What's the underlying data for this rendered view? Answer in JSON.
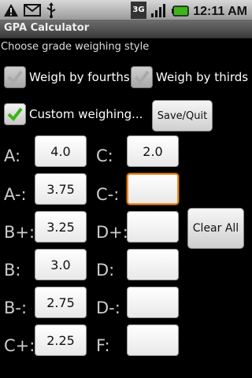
{
  "statusbar": {
    "time": "12:11 AM",
    "icons": [
      "warning-icon",
      "gmail-icon",
      "usb-icon",
      "3g-icon",
      "signal-icon",
      "battery-icon"
    ],
    "network_label": "3G"
  },
  "titlebar": {
    "title": "GPA Calculator"
  },
  "subtitle": "Choose grade weighing style",
  "options": {
    "fourths": {
      "label": "Weigh by fourths",
      "checked": true,
      "enabled": false
    },
    "thirds": {
      "label": "Weigh by thirds",
      "checked": true,
      "enabled": false
    },
    "custom": {
      "label": "Custom weighing...",
      "checked": true,
      "enabled": true
    }
  },
  "buttons": {
    "save_quit": "Save/Quit",
    "clear_all": "Clear All"
  },
  "grades_left": [
    {
      "label": "A:",
      "value": "4.0"
    },
    {
      "label": "A-:",
      "value": "3.75"
    },
    {
      "label": "B+:",
      "value": "3.25"
    },
    {
      "label": "B:",
      "value": "3.0"
    },
    {
      "label": "B-:",
      "value": "2.75"
    },
    {
      "label": "C+:",
      "value": "2.25"
    }
  ],
  "grades_right": [
    {
      "label": "C:",
      "value": "2.0"
    },
    {
      "label": "C-:",
      "value": ""
    },
    {
      "label": "D+:",
      "value": ""
    },
    {
      "label": "D:",
      "value": ""
    },
    {
      "label": "D-:",
      "value": ""
    },
    {
      "label": "F:",
      "value": ""
    }
  ],
  "colors": {
    "focus": "#f08a22",
    "check_green": "#3fb31b",
    "background": "#000000"
  }
}
